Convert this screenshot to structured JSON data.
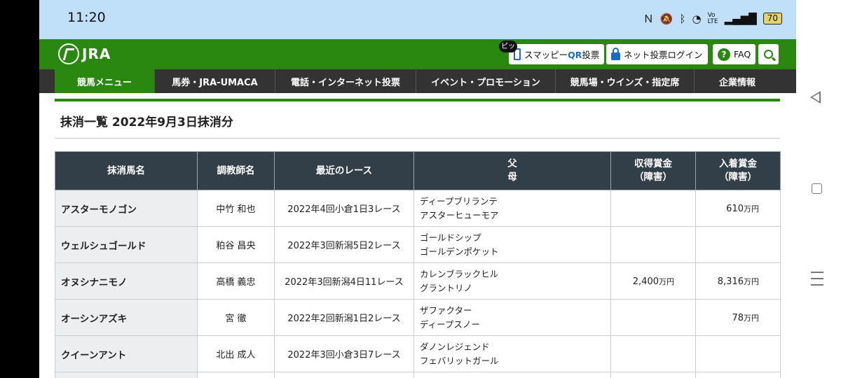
{
  "status": {
    "time": "11:20",
    "battery": "70",
    "icons": [
      "nfc-icon",
      "mute-icon",
      "bluetooth-icon",
      "wifi-icon",
      "volte-icon",
      "signal-icon"
    ]
  },
  "header": {
    "logo_text": "JRA",
    "smappy_badge": "ピッ",
    "smappy_label": "スマッピー",
    "smappy_qr": "QR",
    "smappy_suffix": "投票",
    "netlogin_label": "ネット投票ログイン",
    "faq_label": "FAQ"
  },
  "gnav": [
    "競馬メニュー",
    "馬券・JRA-UMACA",
    "電話・インターネット投票",
    "イベント・プロモーション",
    "競馬場・ウインズ・指定席",
    "企業情報"
  ],
  "page_title": "抹消一覧 2022年9月3日抹消分",
  "table": {
    "headers": {
      "horse": "抹消馬名",
      "trainer": "調教師名",
      "race": "最近のレース",
      "sire": "父",
      "dam": "母",
      "earned": "収得賞金",
      "earned_sub": "（障害）",
      "placed": "入着賞金",
      "placed_sub": "（障害）"
    },
    "rows": [
      {
        "horse": "アスターモノゴン",
        "trainer": "中竹 和也",
        "race": "2022年4回小倉1日3レース",
        "sire": "ディープブリランテ",
        "dam": "アスターヒューモア",
        "earned": "",
        "earned_unit": "",
        "placed": "610",
        "placed_unit": "万円"
      },
      {
        "horse": "ウェルシュゴールド",
        "trainer": "粕谷 昌央",
        "race": "2022年3回新潟5日2レース",
        "sire": "ゴールドシップ",
        "dam": "ゴールデンポケット",
        "earned": "",
        "earned_unit": "",
        "placed": "",
        "placed_unit": ""
      },
      {
        "horse": "オヌシナニモノ",
        "trainer": "高橋 義忠",
        "race": "2022年3回新潟4日11レース",
        "sire": "カレンブラックヒル",
        "dam": "グラントリノ",
        "earned": "2,400",
        "earned_unit": "万円",
        "placed": "8,316",
        "placed_unit": "万円"
      },
      {
        "horse": "オーシンアズキ",
        "trainer": "宮 徹",
        "race": "2022年2回新潟1日2レース",
        "sire": "ザファクター",
        "dam": "ディープスノー",
        "earned": "",
        "earned_unit": "",
        "placed": "78",
        "placed_unit": "万円"
      },
      {
        "horse": "クイーンアント",
        "trainer": "北出 成人",
        "race": "2022年3回小倉3日7レース",
        "sire": "ダノンレジェンド",
        "dam": "フェバリットガール",
        "earned": "",
        "earned_unit": "",
        "placed": "",
        "placed_unit": ""
      }
    ]
  }
}
